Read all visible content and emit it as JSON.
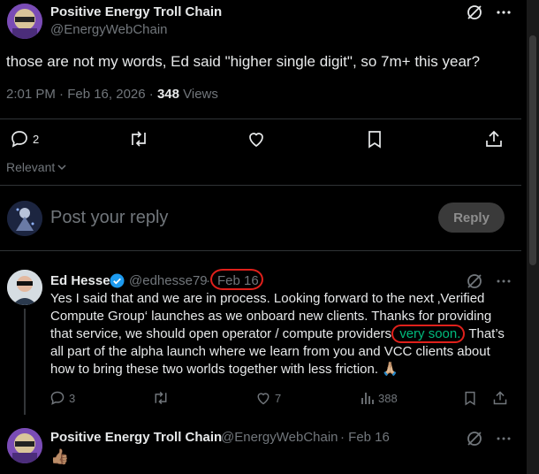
{
  "main_tweet": {
    "display_name": "Positive Energy Troll Chain",
    "handle": "@EnergyWebChain",
    "text": "those are not my words, Ed said \"higher single digit\", so 7m+ this year?",
    "time": "2:01 PM · Feb 16, 2026 · ",
    "views_count": "348",
    "views_label": " Views",
    "replies": "2"
  },
  "sort_label": "Relevant",
  "reply_box": {
    "placeholder": "Post your reply",
    "button_label": "Reply"
  },
  "reply1": {
    "display_name": "Ed Hesse",
    "handle": "@edhesse79",
    "dot": "·",
    "date": "Feb 16",
    "text_part1": "Yes I said that and we are in process. Looking forward to the next ‚Verified Compute Group‘ launches as we onboard new clients. Thanks for providing that service, we should open operator / compute providers",
    "text_highlight": " very soon.",
    "text_part2": "That’s all part of the alpha launch where we learn from you and VCC clients about how to bring these two worlds together with less friction. 🙏🏼",
    "replies": "3",
    "likes": "7",
    "views": "388"
  },
  "reply2": {
    "display_name": "Positive Energy Troll Chain",
    "handle": "@EnergyWebChain",
    "date": "· Feb 16",
    "text": "👍🏽"
  },
  "colors": {
    "background": "#000000",
    "text": "#e7e9ea",
    "muted": "#71767b",
    "verified": "#1d9bf0",
    "highlight_green": "#00ba7c",
    "annotation_red": "#e0201b"
  }
}
